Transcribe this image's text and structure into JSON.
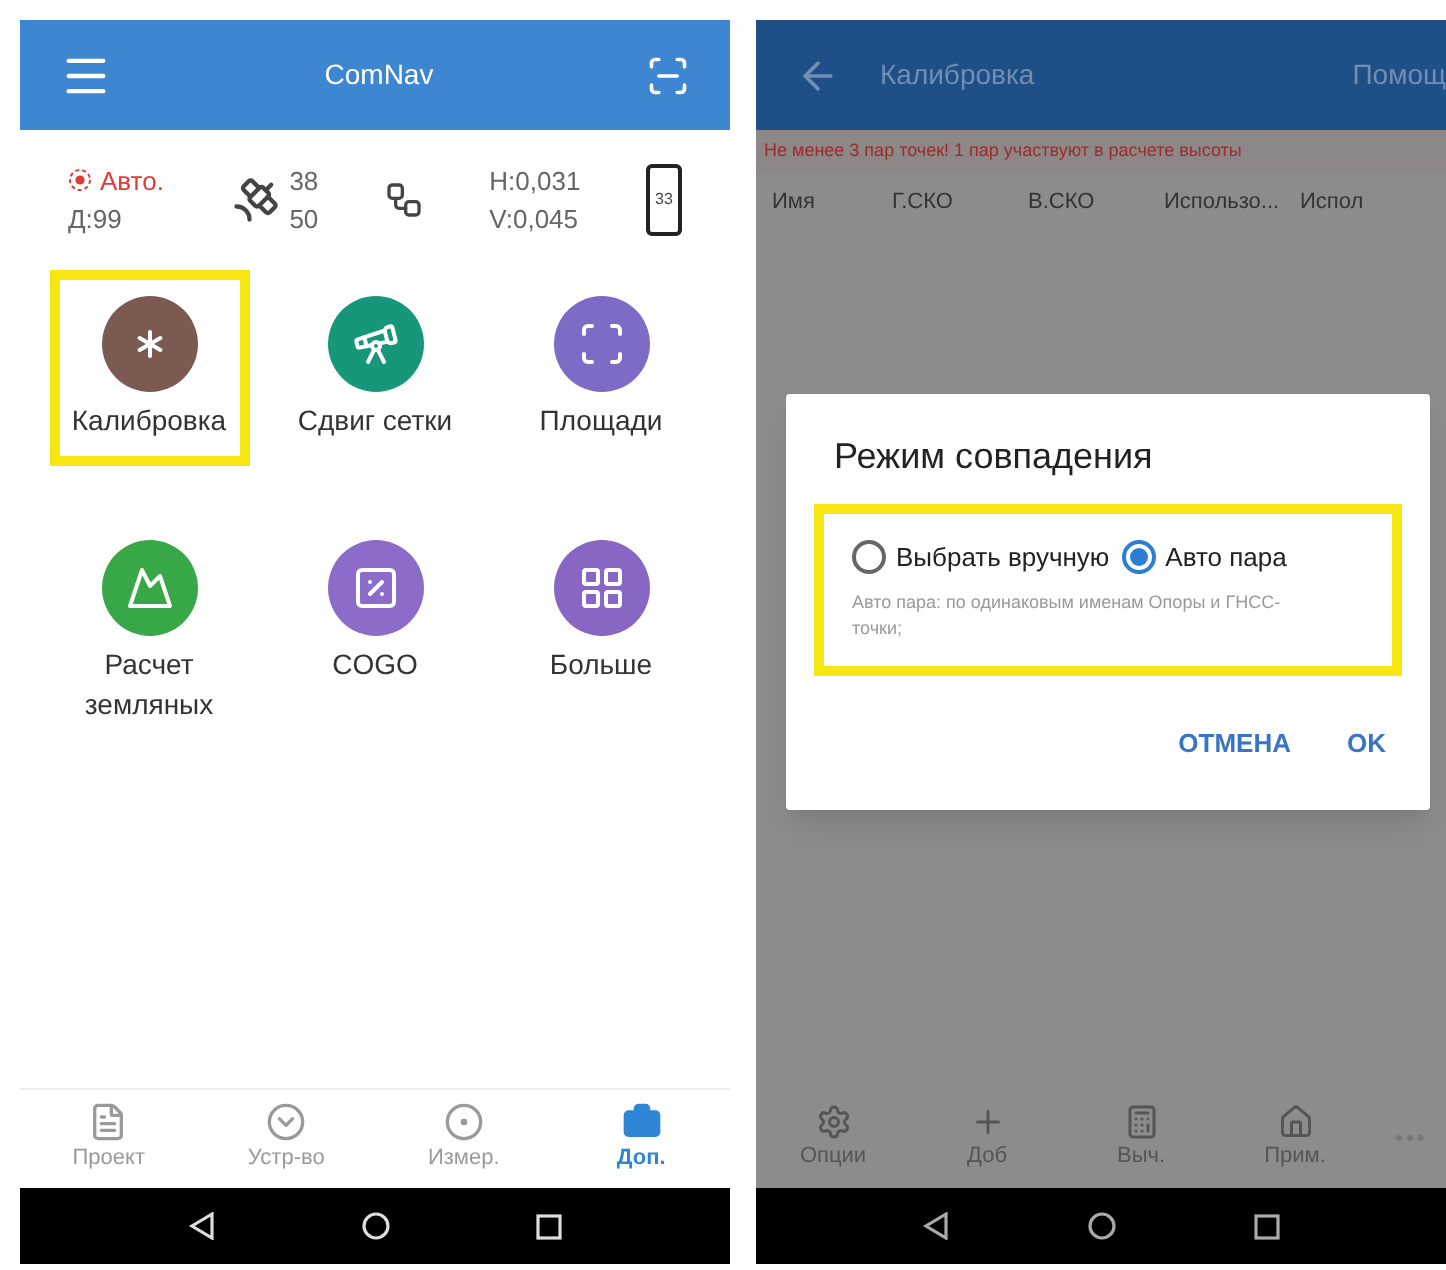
{
  "left": {
    "header": {
      "title": "ComNav"
    },
    "status": {
      "mode": "Авто.",
      "age": "Д:99",
      "sats_used": "38",
      "sats_seen": "50",
      "h_precision": "H:0,031",
      "v_precision": "V:0,045",
      "battery": "33"
    },
    "tiles": [
      {
        "label": "Калибровка",
        "color": "#7b5a52",
        "highlighted": true
      },
      {
        "label": "Сдвиг сетки",
        "color": "#17977a",
        "highlighted": false
      },
      {
        "label": "Площади",
        "color": "#7d6bc6",
        "highlighted": false
      },
      {
        "label": "Расчет земляных",
        "color": "#38a748",
        "highlighted": false
      },
      {
        "label": "COGO",
        "color": "#8b6cc8",
        "highlighted": false
      },
      {
        "label": "Больше",
        "color": "#8866c4",
        "highlighted": false
      }
    ],
    "tabs": [
      {
        "label": "Проект",
        "selected": false
      },
      {
        "label": "Устр-во",
        "selected": false
      },
      {
        "label": "Измер.",
        "selected": false
      },
      {
        "label": "Доп.",
        "selected": true
      }
    ]
  },
  "right": {
    "header": {
      "title": "Калибровка",
      "action": "Помощ"
    },
    "warning": "Не менее 3 пар точек! 1 пар участвуют в расчете высоты",
    "columns": [
      "Имя",
      "Г.СКО",
      "В.СКО",
      "Использо...",
      "Испол"
    ],
    "dialog": {
      "title": "Режим совпадения",
      "highlighted": true,
      "options": [
        {
          "label": "Выбрать вручную",
          "selected": false
        },
        {
          "label": "Авто пара",
          "selected": true
        }
      ],
      "hint": "Авто пара: по одинаковым именам Опоры и ГНСС-точки;",
      "buttons": [
        "ОТМЕНА",
        "OK"
      ]
    },
    "toolbar": [
      {
        "label": "Опции"
      },
      {
        "label": "Доб"
      },
      {
        "label": "Выч."
      },
      {
        "label": "Прим."
      }
    ]
  }
}
